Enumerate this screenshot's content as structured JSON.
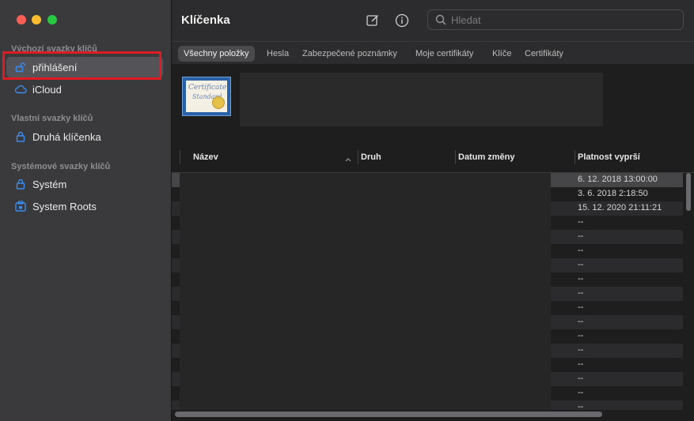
{
  "window": {
    "traffic_lights": [
      "close",
      "minimize",
      "zoom"
    ],
    "colors": {
      "close": "#ff5f57",
      "minimize": "#febc2e",
      "zoom": "#28c840",
      "highlight": "#e01b24"
    }
  },
  "sidebar": {
    "sections": [
      {
        "title": "Výchozí svazky klíčů",
        "items": [
          {
            "label": "přihlášení",
            "icon": "unlocked-padlock-icon",
            "selected": true
          },
          {
            "label": "iCloud",
            "icon": "icloud-icon",
            "selected": false
          }
        ]
      },
      {
        "title": "Vlastní svazky klíčů",
        "items": [
          {
            "label": "Druhá klíčenka",
            "icon": "padlock-icon",
            "selected": false
          }
        ]
      },
      {
        "title": "Systémové svazky klíčů",
        "items": [
          {
            "label": "Systém",
            "icon": "padlock-icon",
            "selected": false
          },
          {
            "label": "System Roots",
            "icon": "system-roots-icon",
            "selected": false
          }
        ]
      }
    ]
  },
  "toolbar": {
    "title": "Klíčenka",
    "compose_icon": "compose-icon",
    "info_icon": "info-icon",
    "search_placeholder": "Hledat"
  },
  "tabs": [
    {
      "label": "Všechny položky",
      "active": true
    },
    {
      "label": "Hesla",
      "active": false
    },
    {
      "label": "Zabezpečené poznámky",
      "active": false
    },
    {
      "label": "Moje certifikáty",
      "active": false
    },
    {
      "label": "Klíče",
      "active": false
    },
    {
      "label": "Certifikáty",
      "active": false
    }
  ],
  "certificate_preview": {
    "line1": "Certificate",
    "line2": "Standard"
  },
  "table": {
    "columns": [
      "Název",
      "Druh",
      "Datum změny",
      "Platnost vyprší"
    ],
    "sort_icon": "chevron-up-icon",
    "expiry_values": [
      "6. 12. 2018 13:00:00",
      "3. 6. 2018 2:18:50",
      "15. 12. 2020 21:11:21",
      "--",
      "--",
      "--",
      "--",
      "--",
      "--",
      "--",
      "--",
      "--",
      "--",
      "--",
      "--",
      "--",
      "--"
    ]
  }
}
